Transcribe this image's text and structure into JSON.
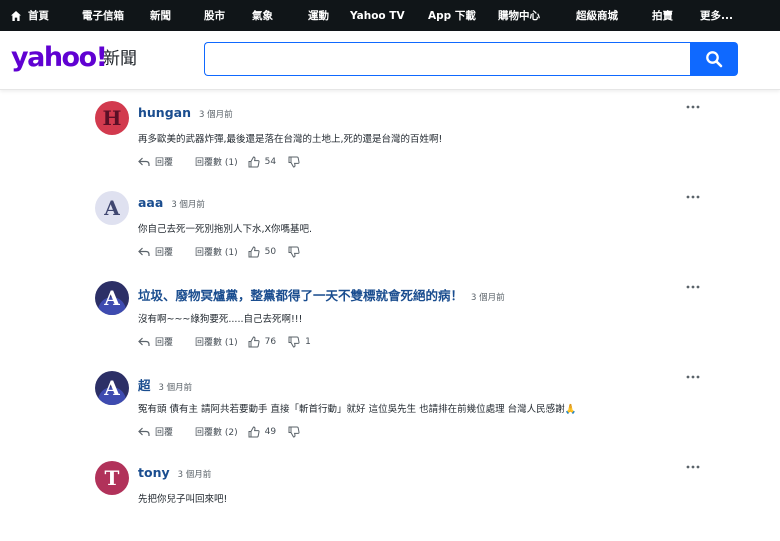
{
  "nav": {
    "items": [
      "首頁",
      "電子信箱",
      "新聞",
      "股市",
      "氣象",
      "運動",
      "Yahoo TV",
      "App 下載",
      "購物中心",
      "超級商城",
      "拍賣",
      "更多..."
    ]
  },
  "header": {
    "logo": "yahoo!",
    "section": "新聞",
    "search_value": ""
  },
  "labels": {
    "reply": "回覆"
  },
  "comments": [
    {
      "author": "hungan",
      "time": "3 個月前",
      "text": "再多歐美的武器炸彈,最後還是落在台灣的土地上,死的還是台灣的百姓啊!",
      "replies": "回覆數 (1)",
      "likes": "54",
      "dislikes": ""
    },
    {
      "author": "aaa",
      "time": "3 個月前",
      "text": "你自己去死一死別拖別人下水,X你嗎基吧.",
      "replies": "回覆數 (1)",
      "likes": "50",
      "dislikes": ""
    },
    {
      "author": "垃圾、廢物冥爐黨，整黨都得了一天不雙標就會死絕的病！",
      "time": "3 個月前",
      "text": "沒有啊~~~綠狗要死.....自己去死啊!!!",
      "replies": "回覆數 (1)",
      "likes": "76",
      "dislikes": "1"
    },
    {
      "author": "超",
      "time": "3 個月前",
      "text": "冤有頭 債有主 請阿共若要動手 直接「斬首行動」就好 這位吳先生 也請排在前幾位處理 台灣人民感謝🙏",
      "replies": "回覆數 (2)",
      "likes": "49",
      "dislikes": ""
    },
    {
      "author": "tony",
      "time": "3 個月前",
      "text": "先把你兒子叫回來吧!",
      "replies": "",
      "likes": "",
      "dislikes": ""
    }
  ],
  "avatars": [
    "H",
    "A",
    "A",
    "A",
    "T"
  ],
  "colors": {
    "accent": "#0f69ff",
    "brand": "#6001d2",
    "nav_bg": "#101518"
  }
}
